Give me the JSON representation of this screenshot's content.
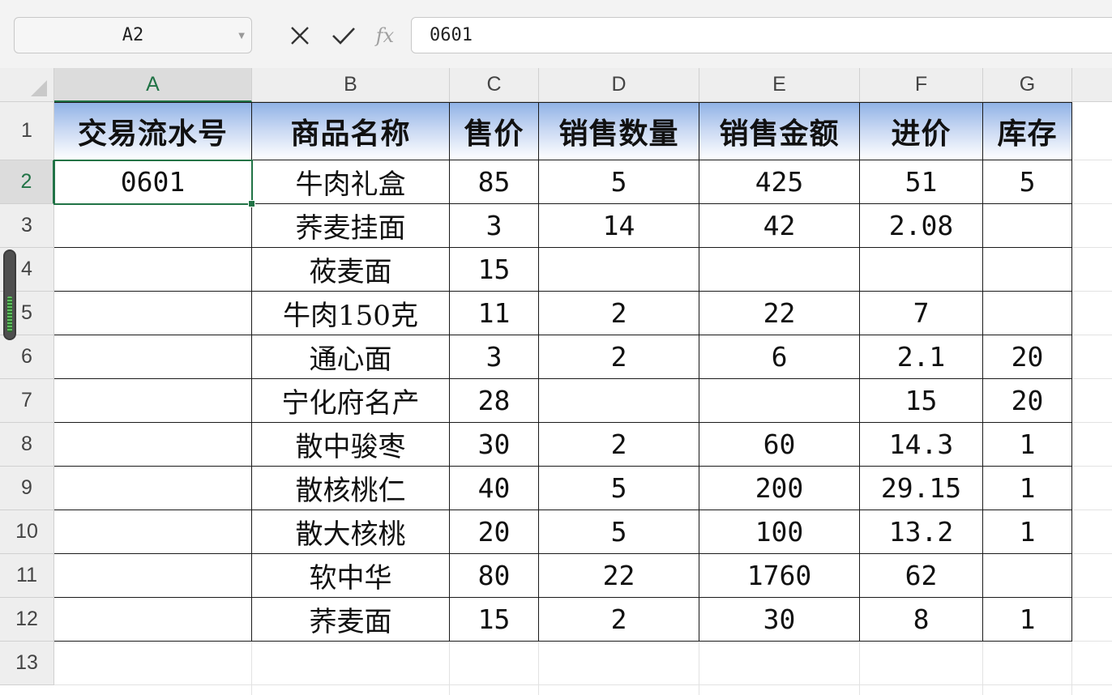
{
  "formula_bar": {
    "name_box": "A2",
    "cancel_icon": "close-icon",
    "confirm_icon": "check-icon",
    "fx_label": "fx",
    "formula_value": "0601"
  },
  "columns": [
    "A",
    "B",
    "C",
    "D",
    "E",
    "F",
    "G"
  ],
  "rows": [
    "1",
    "2",
    "3",
    "4",
    "5",
    "6",
    "7",
    "8",
    "9",
    "10",
    "11",
    "12",
    "13"
  ],
  "table": {
    "headers": [
      "交易流水号",
      "商品名称",
      "售价",
      "销售数量",
      "销售金额",
      "进价",
      "库存"
    ],
    "body": [
      [
        "0601",
        "牛肉礼盒",
        "85",
        "5",
        "425",
        "51",
        "5"
      ],
      [
        "",
        "荞麦挂面",
        "3",
        "14",
        "42",
        "2.08",
        ""
      ],
      [
        "",
        "莜麦面",
        "15",
        "",
        "",
        "",
        ""
      ],
      [
        "",
        "牛肉150克",
        "11",
        "2",
        "22",
        "7",
        ""
      ],
      [
        "",
        "通心面",
        "3",
        "2",
        "6",
        "2.1",
        "20"
      ],
      [
        "",
        "宁化府名产",
        "28",
        "",
        "",
        "15",
        "20"
      ],
      [
        "",
        "散中骏枣",
        "30",
        "2",
        "60",
        "14.3",
        "1"
      ],
      [
        "",
        "散核桃仁",
        "40",
        "5",
        "200",
        "29.15",
        "1"
      ],
      [
        "",
        "散大核桃",
        "20",
        "5",
        "100",
        "13.2",
        "1"
      ],
      [
        "",
        "软中华",
        "80",
        "22",
        "1760",
        "62",
        ""
      ],
      [
        "",
        "荞麦面",
        "15",
        "2",
        "30",
        "8",
        "1"
      ]
    ]
  },
  "selection": {
    "active_cell": "A2"
  },
  "colors": {
    "accent": "#217346",
    "header_gradient_top": "#8fb2e6",
    "table_border": "#1a1a1a"
  }
}
